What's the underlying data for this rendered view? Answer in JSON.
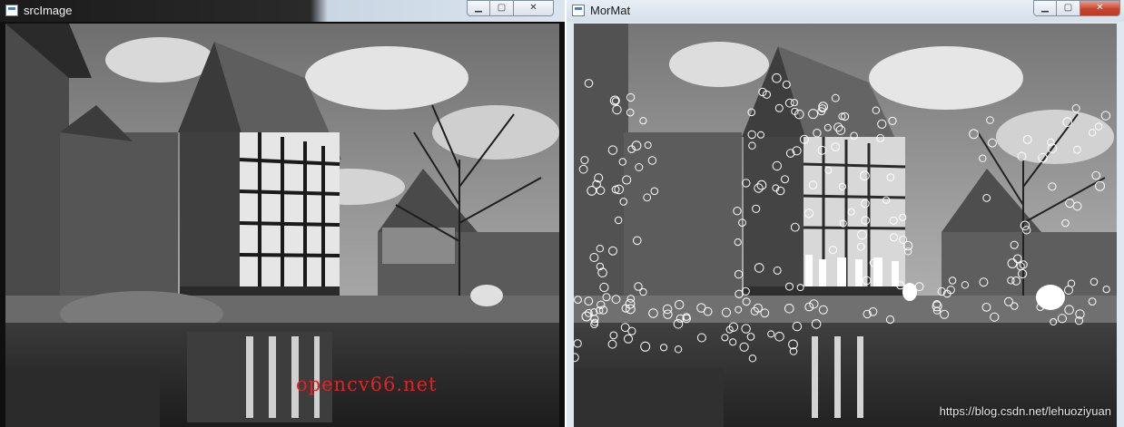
{
  "windows": {
    "left": {
      "title": "srcImage",
      "buttons": {
        "minimize": "▁",
        "maximize": "▢",
        "close": "✕"
      }
    },
    "right": {
      "title": "MorMat",
      "buttons": {
        "minimize": "▁",
        "maximize": "▢",
        "close": "✕"
      }
    }
  },
  "overlay": {
    "watermark": "opencv66.net",
    "url": "https://blog.csdn.net/lehuoziyuan"
  },
  "colors": {
    "watermark": "#e52222",
    "keypoints": "#ffffff",
    "close_button": "#c8452e"
  },
  "icons": [
    "app-icon",
    "minimize-icon",
    "maximize-icon",
    "close-icon"
  ]
}
